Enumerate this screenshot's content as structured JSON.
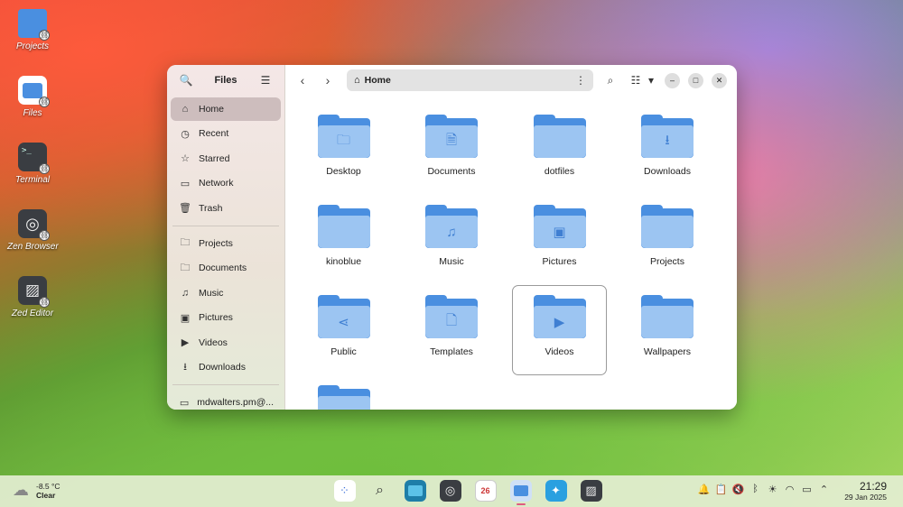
{
  "desktop": {
    "icons": [
      {
        "label": "Projects"
      },
      {
        "label": "Files"
      },
      {
        "label": "Terminal"
      },
      {
        "label": "Zen Browser"
      },
      {
        "label": "Zed Editor"
      }
    ]
  },
  "window": {
    "sidebar": {
      "title": "Files",
      "items": [
        {
          "label": "Home",
          "icon": "home-icon",
          "active": true
        },
        {
          "label": "Recent",
          "icon": "clock-icon"
        },
        {
          "label": "Starred",
          "icon": "star-icon"
        },
        {
          "label": "Network",
          "icon": "network-icon"
        },
        {
          "label": "Trash",
          "icon": "trash-icon"
        }
      ],
      "bookmarks": [
        {
          "label": "Projects",
          "icon": "folder-icon"
        },
        {
          "label": "Documents",
          "icon": "folder-icon"
        },
        {
          "label": "Music",
          "icon": "music-icon"
        },
        {
          "label": "Pictures",
          "icon": "picture-icon"
        },
        {
          "label": "Videos",
          "icon": "video-icon"
        },
        {
          "label": "Downloads",
          "icon": "download-icon"
        }
      ],
      "account": {
        "label": "mdwalters.pm@..."
      }
    },
    "path": {
      "current": "Home"
    },
    "folders": [
      {
        "name": "Desktop",
        "glyph": "🗀"
      },
      {
        "name": "Documents",
        "glyph": "🗎"
      },
      {
        "name": "dotfiles",
        "glyph": ""
      },
      {
        "name": "Downloads",
        "glyph": "⭳"
      },
      {
        "name": "kinoblue",
        "glyph": ""
      },
      {
        "name": "Music",
        "glyph": "♫"
      },
      {
        "name": "Pictures",
        "glyph": "▣"
      },
      {
        "name": "Projects",
        "glyph": ""
      },
      {
        "name": "Public",
        "glyph": "⋖"
      },
      {
        "name": "Templates",
        "glyph": "🗋"
      },
      {
        "name": "Videos",
        "glyph": "▶"
      },
      {
        "name": "Wallpapers",
        "glyph": ""
      },
      {
        "name": "",
        "glyph": ""
      }
    ]
  },
  "taskbar": {
    "weather": {
      "temp": "-8.5 °C",
      "condition": "Clear"
    },
    "calendar_day": "26",
    "clock": {
      "time": "21:29",
      "date": "29 Jan 2025"
    }
  }
}
